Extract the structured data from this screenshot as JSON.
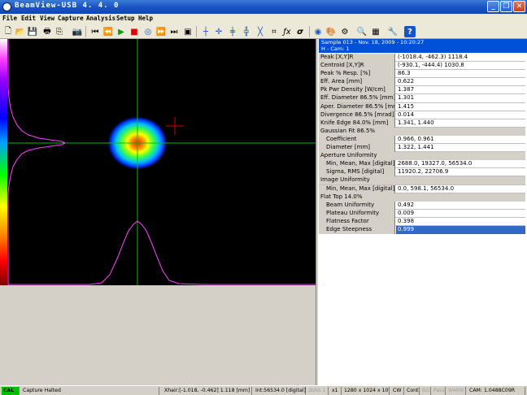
{
  "window": {
    "title": "BeamView-USB  4. 4. 0",
    "min_glyph": "_",
    "max_glyph": "❐",
    "close_glyph": "✕"
  },
  "menu": [
    "File",
    "Edit",
    "View",
    "Capture",
    "Analysis",
    "Setup",
    "Help"
  ],
  "toolbar": [
    {
      "name": "new-icon",
      "glyph": "🗋"
    },
    {
      "name": "open-icon",
      "glyph": "📂"
    },
    {
      "name": "save-icon",
      "glyph": "💾"
    },
    {
      "name": "print-icon",
      "glyph": "🖶"
    },
    {
      "name": "copy-icon",
      "glyph": "⎘"
    },
    {
      "name": "camera-icon",
      "glyph": "📷"
    },
    {
      "name": "first-frame-icon",
      "glyph": "⏮"
    },
    {
      "name": "step-back-icon",
      "glyph": "⏪"
    },
    {
      "name": "play-icon",
      "glyph": "▶"
    },
    {
      "name": "stop-icon",
      "glyph": "■"
    },
    {
      "name": "record-icon",
      "glyph": "◎"
    },
    {
      "name": "step-forward-icon",
      "glyph": "⏩"
    },
    {
      "name": "last-frame-icon",
      "glyph": "⏭"
    },
    {
      "name": "snapshot-icon",
      "glyph": "▣"
    },
    {
      "name": "crosshair-icon",
      "glyph": "┼"
    },
    {
      "name": "crosshair-center-icon",
      "glyph": "✛"
    },
    {
      "name": "crosshair-peak-icon",
      "glyph": "╪"
    },
    {
      "name": "crosshair-move-icon",
      "glyph": "╬"
    },
    {
      "name": "rotate-crosshair-icon",
      "glyph": "╳"
    },
    {
      "name": "profile-icon",
      "glyph": "⌗"
    },
    {
      "name": "function-icon",
      "glyph": "ƒx"
    },
    {
      "name": "sigma-icon",
      "glyph": "σ"
    },
    {
      "name": "beam-icon",
      "glyph": "◉"
    },
    {
      "name": "palette-icon",
      "glyph": "🎨"
    },
    {
      "name": "settings-icon",
      "glyph": "⚙"
    },
    {
      "name": "zoom-icon",
      "glyph": "🔍"
    },
    {
      "name": "grid-icon",
      "glyph": "▦"
    },
    {
      "name": "tools-icon",
      "glyph": "🔧"
    },
    {
      "name": "help-icon",
      "glyph": "?"
    }
  ],
  "header": {
    "line1": "Sample  013  -  Nov. 18, 2009  -  10:20:27",
    "line2": "H  -  Cam: 1"
  },
  "results": [
    {
      "label": "Peak [X,Y]R",
      "value": "(-1018.4, -462.3) 1118.4"
    },
    {
      "label": "Centroid [X,Y]R",
      "value": "(-930.1, -444.4) 1030.8"
    },
    {
      "label": "Peak % Resp. [%]",
      "value": "86.3"
    },
    {
      "label": "Eff. Area [mm]",
      "value": "0.622"
    },
    {
      "label": "Pk Pwr Density [W/cm]",
      "value": "1.387"
    },
    {
      "label": "Eff. Diameter 86.5% [mm]",
      "value": "1.301"
    },
    {
      "label": "Aper. Diameter 86.5% [mm]",
      "value": "1.415"
    },
    {
      "label": "Divergence 86.5% [mrad]",
      "value": "0.014"
    },
    {
      "label": "Knife Edge 84.0% [mm]",
      "value": "1.341, 1.440"
    },
    {
      "label": "Gaussian Fit 86.5%",
      "value": "",
      "group": true
    },
    {
      "label": "Coefficient",
      "value": "0.966, 0.961",
      "indent": true
    },
    {
      "label": "Diameter [mm]",
      "value": "1.322, 1.441",
      "indent": true
    },
    {
      "label": "Aperture Uniformity",
      "value": "",
      "group": true
    },
    {
      "label": "Min, Mean, Max [digital]",
      "value": "2688.0, 19327.0, 56534.0",
      "indent": true
    },
    {
      "label": "Sigma, RMS [digital]",
      "value": "11920.2, 22706.9",
      "indent": true
    },
    {
      "label": "Image Uniformity",
      "value": "",
      "group": true
    },
    {
      "label": "Min, Mean, Max [digital]",
      "value": "0.0, 598.1, 56534.0",
      "indent": true
    },
    {
      "label": "Flat Top 14.0%",
      "value": "",
      "group": true
    },
    {
      "label": "Beam Uniformity",
      "value": "0.492",
      "indent": true
    },
    {
      "label": "Plateau Uniformity",
      "value": "0.009",
      "indent": true
    },
    {
      "label": "Flatness Factor",
      "value": "0.398",
      "indent": true
    },
    {
      "label": "Edge Steepness",
      "value": "0.999",
      "indent": true,
      "selected": true
    }
  ],
  "status": {
    "cal": "CAL",
    "state": "Capture Halted",
    "xhair": "Xhair:[-1.018, -0.462] 1.118 [mm]",
    "int": "Int:56534.0 [digital]",
    "bias": "BIAS 1",
    "zoom": "x1",
    "res": "1280 x 1024 x 10",
    "cw": "CW",
    "cont": "Cont",
    "bg": "BG",
    "pass": "Pass",
    "warn": "WARN",
    "cam": "CAM: 1.0488C09R"
  },
  "colors": {
    "cal_bg": "#00c000",
    "crosshair": "#00c000",
    "profile": "#ff40ff",
    "header_bg": "#0050d8"
  }
}
